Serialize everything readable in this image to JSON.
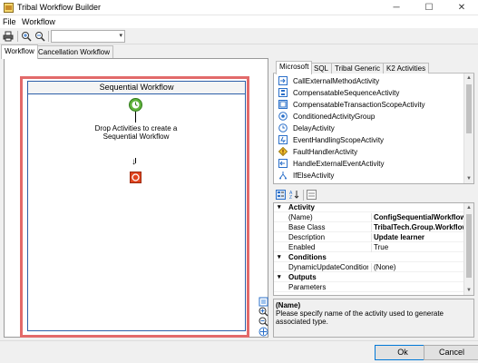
{
  "window": {
    "title": "Tribal Workflow Builder",
    "minimize": "─",
    "maximize": "☐",
    "close": "✕"
  },
  "menu": [
    "File",
    "Workflow"
  ],
  "toolbar": {
    "zoom_value": ""
  },
  "main_tabs": [
    "Workflow",
    "Cancellation Workflow"
  ],
  "designer": {
    "header": "Sequential Workflow",
    "drop_text": "Drop Activities to create a Sequential Workflow",
    "arrow": "↓"
  },
  "toolbox_tabs": [
    "Microsoft",
    "SQL",
    "Tribal Generic",
    "K2 Activities"
  ],
  "toolbox_items": [
    {
      "label": "CallExternalMethodActivity",
      "icon": "call-external-method-icon"
    },
    {
      "label": "CompensatableSequenceActivity",
      "icon": "compensatable-sequence-icon"
    },
    {
      "label": "CompensatableTransactionScopeActivity",
      "icon": "compensatable-transaction-icon"
    },
    {
      "label": "ConditionedActivityGroup",
      "icon": "conditioned-group-icon"
    },
    {
      "label": "DelayActivity",
      "icon": "delay-clock-icon"
    },
    {
      "label": "EventHandlingScopeActivity",
      "icon": "event-handling-scope-icon"
    },
    {
      "label": "FaultHandlerActivity",
      "icon": "fault-handler-icon"
    },
    {
      "label": "HandleExternalEventActivity",
      "icon": "handle-external-event-icon"
    },
    {
      "label": "IfElseActivity",
      "icon": "if-else-icon"
    }
  ],
  "properties": {
    "rows": [
      {
        "type": "cat",
        "toggle": "▾",
        "name": "Activity"
      },
      {
        "type": "prop",
        "name": "(Name)",
        "value": "ConfigSequentialWorkflow",
        "bold": true
      },
      {
        "type": "prop",
        "name": "Base Class",
        "value": "TribalTech.Group.Workflow",
        "bold": true
      },
      {
        "type": "prop",
        "name": "Description",
        "value": "Update learner",
        "bold": true
      },
      {
        "type": "prop",
        "name": "Enabled",
        "value": "True",
        "bold": false
      },
      {
        "type": "cat",
        "toggle": "▾",
        "name": "Conditions"
      },
      {
        "type": "prop",
        "name": "DynamicUpdateCondition",
        "value": "(None)",
        "bold": false
      },
      {
        "type": "cat",
        "toggle": "▾",
        "name": "Outputs"
      },
      {
        "type": "prop",
        "name": "Parameters",
        "value": "",
        "bold": false
      }
    ],
    "description_title": "(Name)",
    "description_text": "Please specify name of the activity used to generate associated type."
  },
  "buttons": {
    "ok": "Ok",
    "cancel": "Cancel"
  },
  "colors": {
    "highlight": "#e26a6a",
    "workflow_border": "#2d5fa8",
    "accent": "#0078d7"
  }
}
